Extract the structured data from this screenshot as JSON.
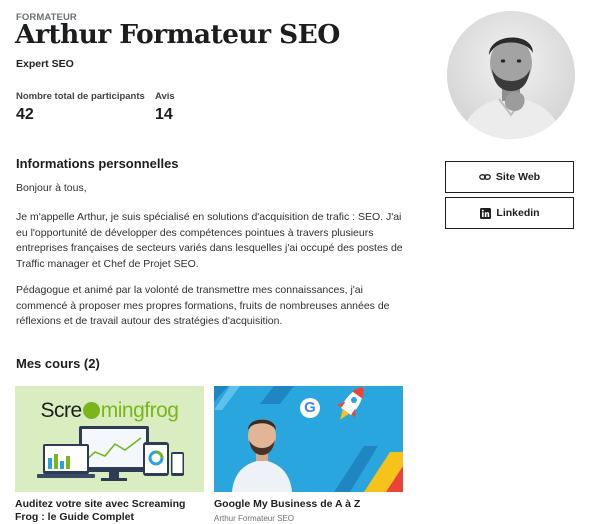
{
  "instructor": {
    "role_label": "FORMATEUR",
    "name": "Arthur Formateur SEO",
    "headline": "Expert SEO"
  },
  "stats": [
    {
      "label": "Nombre total de participants",
      "value": "42"
    },
    {
      "label": "Avis",
      "value": "14"
    }
  ],
  "about": {
    "title": "Informations personnelles",
    "paragraphs": [
      "Bonjour à tous,",
      "Je m'appelle Arthur, je suis spécialisé en solutions d'acquisition de trafic : SEO. J'ai eu l'opportunité de développer des compétences pointues à travers plusieurs entreprises françaises de secteurs variés dans lesquelles j'ai occupé des postes de Traffic manager et Chef de Projet SEO.",
      "Pédagogue et animé par la volonté de transmettre mes connaissances, j'ai commencé à proposer mes propres formations, fruits de nombreuses années de réflexions et de travail autour des stratégies d'acquisition."
    ]
  },
  "links": [
    {
      "label": "Site Web",
      "icon": "link-icon"
    },
    {
      "label": "Linkedin",
      "icon": "linkedin-icon"
    }
  ],
  "courses": {
    "title": "Mes cours (2)",
    "items": [
      {
        "title": "Auditez votre site avec Screaming Frog : le Guide Complet",
        "author": "",
        "thumb_logo_text_1": "Scre",
        "thumb_logo_text_2": "mingfrog"
      },
      {
        "title": "Google My Business de A à Z",
        "author": "Arthur Formateur SEO",
        "thumb_logo_text_1": "G"
      }
    ]
  },
  "colors": {
    "text": "#1c1d1f",
    "muted": "#6a6f73",
    "frog_green": "#7ab51d",
    "gmb_blue": "#29a3dc"
  }
}
